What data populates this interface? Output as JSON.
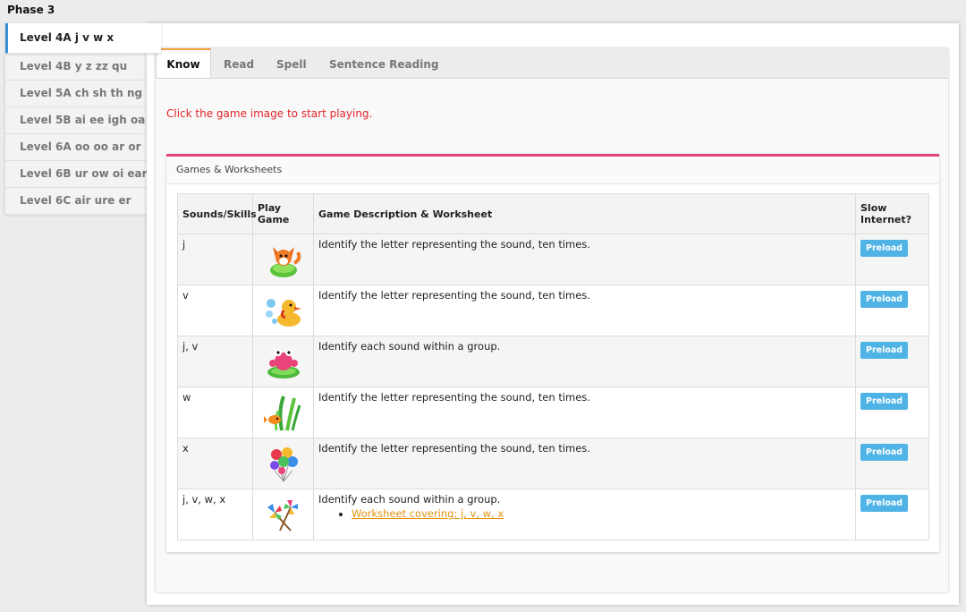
{
  "phase_title": "Phase 3",
  "levels": [
    {
      "label": "Level 4A j v w x",
      "active": true
    },
    {
      "label": "Level 4B y z zz qu",
      "active": false
    },
    {
      "label": "Level 5A ch sh th ng",
      "active": false
    },
    {
      "label": "Level 5B ai ee igh oa",
      "active": false
    },
    {
      "label": "Level 6A oo oo ar or",
      "active": false
    },
    {
      "label": "Level 6B ur ow oi ear",
      "active": false
    },
    {
      "label": "Level 6C air ure er",
      "active": false
    }
  ],
  "tabs": [
    {
      "label": "Know",
      "active": true
    },
    {
      "label": "Read",
      "active": false
    },
    {
      "label": "Spell",
      "active": false
    },
    {
      "label": "Sentence Reading",
      "active": false
    }
  ],
  "instruction": "Click the game image to start playing.",
  "panel_title": "Games & Worksheets",
  "table": {
    "headers": {
      "sounds": "Sounds/Skills",
      "play_line1": "Play",
      "play_line2": "Game",
      "description": "Game Description & Worksheet",
      "slow_line1": "Slow",
      "slow_line2": "Internet?"
    },
    "rows": [
      {
        "sounds": "j",
        "icon": "fox-game-icon",
        "description": "Identify the letter representing the sound, ten times.",
        "button": "Preload"
      },
      {
        "sounds": "v",
        "icon": "duck-game-icon",
        "description": "Identify the letter representing the sound, ten times.",
        "button": "Preload"
      },
      {
        "sounds": "j, v",
        "icon": "frog-game-icon",
        "description": "Identify each sound within a group.",
        "button": "Preload"
      },
      {
        "sounds": "w",
        "icon": "fish-weed-game-icon",
        "description": "Identify the letter representing the sound, ten times.",
        "button": "Preload"
      },
      {
        "sounds": "x",
        "icon": "balloons-game-icon",
        "description": "Identify the letter representing the sound, ten times.",
        "button": "Preload"
      },
      {
        "sounds": "j, v, w, x",
        "icon": "windmills-game-icon",
        "description": "Identify each sound within a group.",
        "worksheet_link": "Worksheet covering: j, v, w, x",
        "button": "Preload"
      }
    ]
  },
  "colors": {
    "accent_blue": "#3a8ed4",
    "tab_accent": "#f0a03c",
    "panel_accent": "#e0457e",
    "instruction_red": "#e0242a",
    "preload_button": "#4fb3e6",
    "link_orange": "#e3930b"
  }
}
